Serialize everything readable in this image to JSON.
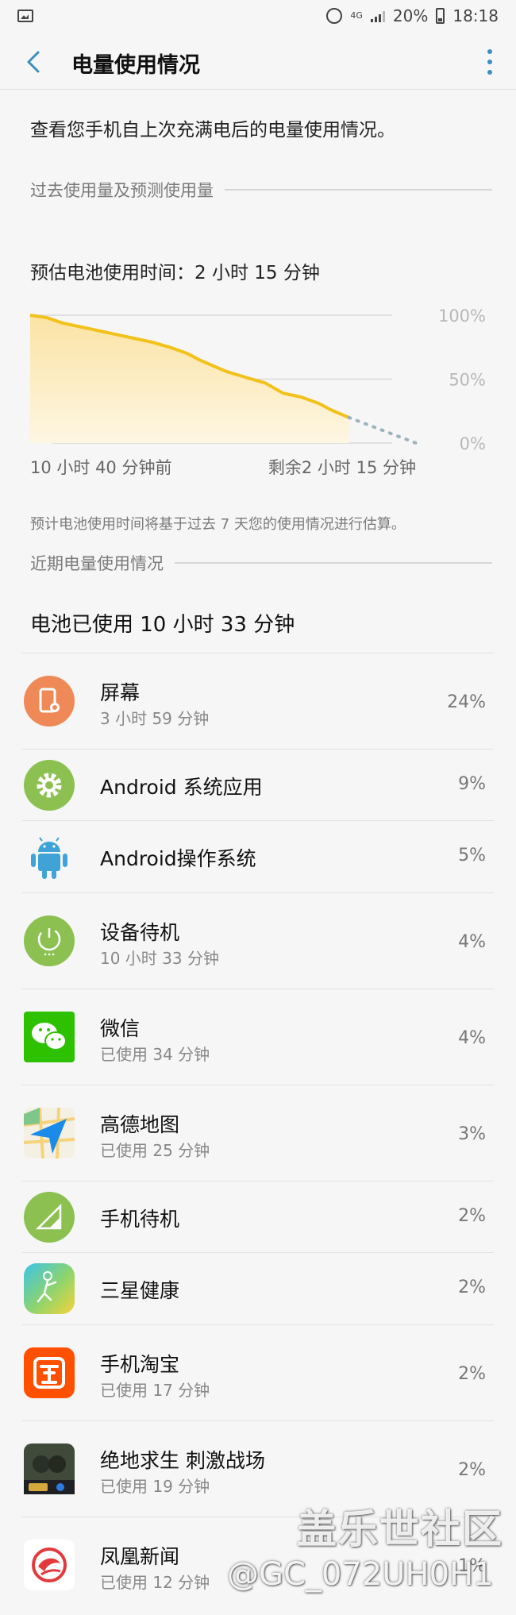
{
  "status_bar": {
    "network": "4G",
    "battery_percent": "20%",
    "time": "18:18"
  },
  "header": {
    "title": "电量使用情况"
  },
  "description": "查看您手机自上次充满电后的电量使用情况。",
  "past_section": {
    "label": "过去使用量及预测使用量",
    "estimate_text": "预估电池使用时间：2 小时 15 分钟",
    "note": "预计电池使用时间将基于过去 7 天您的使用情况进行估算。"
  },
  "chart_data": {
    "type": "area",
    "title": "",
    "x_labels": [
      "10 小时 40 分钟前",
      "剩余2 小时 15 分钟"
    ],
    "y_ticks": [
      "100%",
      "50%",
      "0%"
    ],
    "ylim": [
      0,
      100
    ],
    "x_range_hours": [
      -10.67,
      2.25
    ],
    "series": [
      {
        "kind": "actual",
        "color": "#f2c21b",
        "points": [
          [
            -10.67,
            100
          ],
          [
            -10.1,
            98
          ],
          [
            -9.6,
            94
          ],
          [
            -9.0,
            91
          ],
          [
            -8.4,
            88
          ],
          [
            -7.8,
            85
          ],
          [
            -7.2,
            82
          ],
          [
            -6.6,
            79
          ],
          [
            -6.0,
            75
          ],
          [
            -5.4,
            70
          ],
          [
            -5.0,
            65
          ],
          [
            -4.6,
            61
          ],
          [
            -4.1,
            56
          ],
          [
            -3.4,
            51
          ],
          [
            -2.8,
            47
          ],
          [
            -2.2,
            39
          ],
          [
            -1.6,
            36
          ],
          [
            -1.0,
            31
          ],
          [
            -0.6,
            26
          ],
          [
            0,
            20
          ]
        ]
      },
      {
        "kind": "predicted",
        "color": "#9cb2bd",
        "points": [
          [
            0,
            20
          ],
          [
            2.25,
            0
          ]
        ]
      }
    ]
  },
  "recent_section": {
    "label": "近期电量使用情况",
    "total_used": "电池已使用 10 小时 33 分钟"
  },
  "apps": [
    {
      "name": "屏幕",
      "sub": "3 小时 59 分钟",
      "percent": "24%",
      "icon": "screen-icon"
    },
    {
      "name": "Android 系统应用",
      "sub": "",
      "percent": "9%",
      "icon": "android-system-icon"
    },
    {
      "name": "Android操作系统",
      "sub": "",
      "percent": "5%",
      "icon": "android-os-icon"
    },
    {
      "name": "设备待机",
      "sub": "10 小时 33 分钟",
      "percent": "4%",
      "icon": "device-idle-icon"
    },
    {
      "name": "微信",
      "sub": "已使用 34 分钟",
      "percent": "4%",
      "icon": "wechat-icon"
    },
    {
      "name": "高德地图",
      "sub": "已使用 25 分钟",
      "percent": "3%",
      "icon": "amap-icon"
    },
    {
      "name": "手机待机",
      "sub": "",
      "percent": "2%",
      "icon": "cell-standby-icon"
    },
    {
      "name": "三星健康",
      "sub": "",
      "percent": "2%",
      "icon": "samsung-health-icon"
    },
    {
      "name": "手机淘宝",
      "sub": "已使用 17 分钟",
      "percent": "2%",
      "icon": "taobao-icon"
    },
    {
      "name": "绝地求生 刺激战场",
      "sub": "已使用 19 分钟",
      "percent": "2%",
      "icon": "pubg-icon"
    },
    {
      "name": "凤凰新闻",
      "sub": "已使用 12 分钟",
      "percent": "1%",
      "icon": "ifeng-news-icon"
    }
  ],
  "watermark": {
    "site": "盖乐世社区",
    "user": "@GC_072UH0H1"
  }
}
